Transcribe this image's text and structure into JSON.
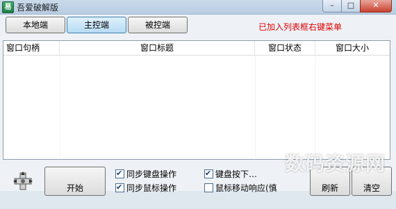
{
  "window": {
    "title": "吾爱破解版",
    "app_icon_glyph": "易",
    "minimize_glyph": "–",
    "maximize_glyph": "□",
    "close_glyph": "✕"
  },
  "toolbar": {
    "local_label": "本地端",
    "master_label": "主控端",
    "controlled_label": "被控端",
    "notice_text": "已加入列表框右键菜单"
  },
  "list": {
    "columns": [
      "窗口句柄",
      "窗口标题",
      "窗口状态",
      "窗口大小"
    ]
  },
  "controls": {
    "start_label": "开始",
    "sync_keyboard_label": "同步键盘操作",
    "sync_mouse_label": "同步鼠标操作",
    "keyboard_option_label": "键盘按下…",
    "mouse_option_label": "鼠标移动响应(慎",
    "refresh_label": "刷新",
    "clear_label": "清空"
  },
  "watermark": "数码资源网",
  "colors": {
    "notice": "#e00000",
    "active_tab": "#b6dcf3"
  }
}
